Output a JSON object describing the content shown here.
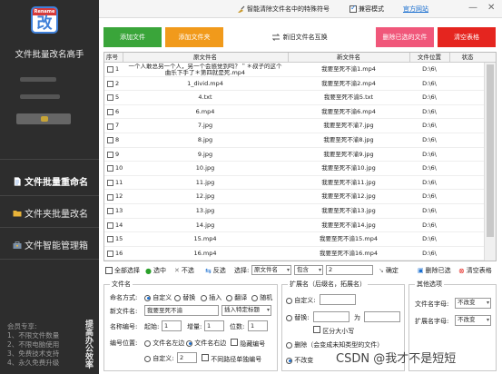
{
  "sidebar": {
    "logo_badge": "Rename",
    "logo_glyph": "改",
    "app_title": "文件批量改名高手",
    "items": [
      {
        "label": "文件批量重命名",
        "icon": "document-icon"
      },
      {
        "label": "文件夹批量改名",
        "icon": "folder-icon"
      },
      {
        "label": "文件智能管理箱",
        "icon": "toolbox-icon"
      }
    ],
    "notes": [
      "会员专享:",
      "1、不限文件数量",
      "2、不限电脑使用",
      "3、免费技术支持",
      "4、永久免费升级"
    ],
    "vertical_text": "提高办公效率"
  },
  "topbar": {
    "smart_clear_label": "智能清除文件名中的特殊符号",
    "compat_mode_label": "兼容模式",
    "compat_mode_checked": true,
    "site_link": "官方网站",
    "win_buttons": [
      "—",
      "✕"
    ]
  },
  "toolbar": {
    "add_file": "添加文件",
    "add_folder": "添加文件夹",
    "swap_label": "新旧文件名互换",
    "remove_selected": "删除已选的文件",
    "clear_table": "清空表格"
  },
  "table": {
    "headers": [
      "序号",
      "原文件名",
      "新文件名",
      "文件位置",
      "状态"
    ],
    "rows": [
      {
        "no": "1",
        "orig": [
          "一个人敢总另一个人，另一个会感觉到吗？＂＊叔子的这个",
          "曲乐下手了＊第四就是死.mp4"
        ],
        "new": "我要至死不渝1.mp4",
        "loc": "D:\\6\\"
      },
      {
        "no": "2",
        "orig": [
          "1_divid.mp4"
        ],
        "new": "我要至死不渝2.mp4",
        "loc": "D:\\6\\"
      },
      {
        "no": "5",
        "orig": [
          "4.txt"
        ],
        "new": "我要至死不渝5.txt",
        "loc": "D:\\6\\"
      },
      {
        "no": "6",
        "orig": [
          "6.mp4"
        ],
        "new": "我要至死不渝6.mp4",
        "loc": "D:\\6\\"
      },
      {
        "no": "7",
        "orig": [
          "7.jpg"
        ],
        "new": "我要至死不渝7.jpg",
        "loc": "D:\\6\\"
      },
      {
        "no": "8",
        "orig": [
          "8.jpg"
        ],
        "new": "我要至死不渝8.jpg",
        "loc": "D:\\6\\"
      },
      {
        "no": "9",
        "orig": [
          "9.jpg"
        ],
        "new": "我要至死不渝9.jpg",
        "loc": "D:\\6\\"
      },
      {
        "no": "10",
        "orig": [
          "10.jpg"
        ],
        "new": "我要至死不渝10.jpg",
        "loc": "D:\\6\\"
      },
      {
        "no": "11",
        "orig": [
          "11.jpg"
        ],
        "new": "我要至死不渝11.jpg",
        "loc": "D:\\6\\"
      },
      {
        "no": "12",
        "orig": [
          "12.jpg"
        ],
        "new": "我要至死不渝12.jpg",
        "loc": "D:\\6\\"
      },
      {
        "no": "13",
        "orig": [
          "13.jpg"
        ],
        "new": "我要至死不渝13.jpg",
        "loc": "D:\\6\\"
      },
      {
        "no": "14",
        "orig": [
          "14.jpg"
        ],
        "new": "我要至死不渝14.jpg",
        "loc": "D:\\6\\"
      },
      {
        "no": "15",
        "orig": [
          "15.mp4"
        ],
        "new": "我要至死不渝15.mp4",
        "loc": "D:\\6\\"
      },
      {
        "no": "16",
        "orig": [
          "16.mp4"
        ],
        "new": "我要至死不渝16.mp4",
        "loc": "D:\\6\\"
      }
    ]
  },
  "actions": {
    "select_all": "全部选择",
    "select": "选中",
    "deselect": "不选",
    "invert": "反选",
    "choose_label": "选择:",
    "field_value": "原文件名",
    "op_value": "包含",
    "match_value": "2",
    "confirm": "确定",
    "delete_selected": "删除已选",
    "clear_table": "清空表格"
  },
  "filename_panel": {
    "title": "文件名",
    "mode_label": "命名方式:",
    "modes": [
      "自定义",
      "替换",
      "插入",
      "翻译",
      "随机"
    ],
    "mode_selected": 0,
    "new_name_label": "新文件名:",
    "new_name_value": "我要至死不渝",
    "insert_special": "插入特定标题",
    "rule_label": "名称编号:",
    "start_label": "起始:",
    "start_value": "1",
    "step_label": "增量:",
    "step_value": "1",
    "digits_label": "位数:",
    "digits_value": "1",
    "pos_label": "编号位置:",
    "pos_left": "文件名左边",
    "pos_right": "文件名右边",
    "pos_selected": 1,
    "hide_number": "隐藏编号",
    "custom_label": "自定义:",
    "custom_value": "2",
    "no_leading_zero": "不同路径单独编号"
  },
  "ext_panel": {
    "title": "扩展名（后缀名，拓展名）",
    "custom": "自定义:",
    "replace": "替换:",
    "replace_to": "为",
    "case_sensitive": "区分大小写",
    "delete": "删除（会变成未知类型的文件）",
    "keep": "不改变",
    "selected": "keep"
  },
  "other_panel": {
    "title": "其他选项",
    "name_case_label": "文件名字母:",
    "name_case_value": "不改变",
    "ext_case_label": "扩展名字母:",
    "ext_case_value": "不改变"
  },
  "watermark": "CSDN @我才不是短短"
}
